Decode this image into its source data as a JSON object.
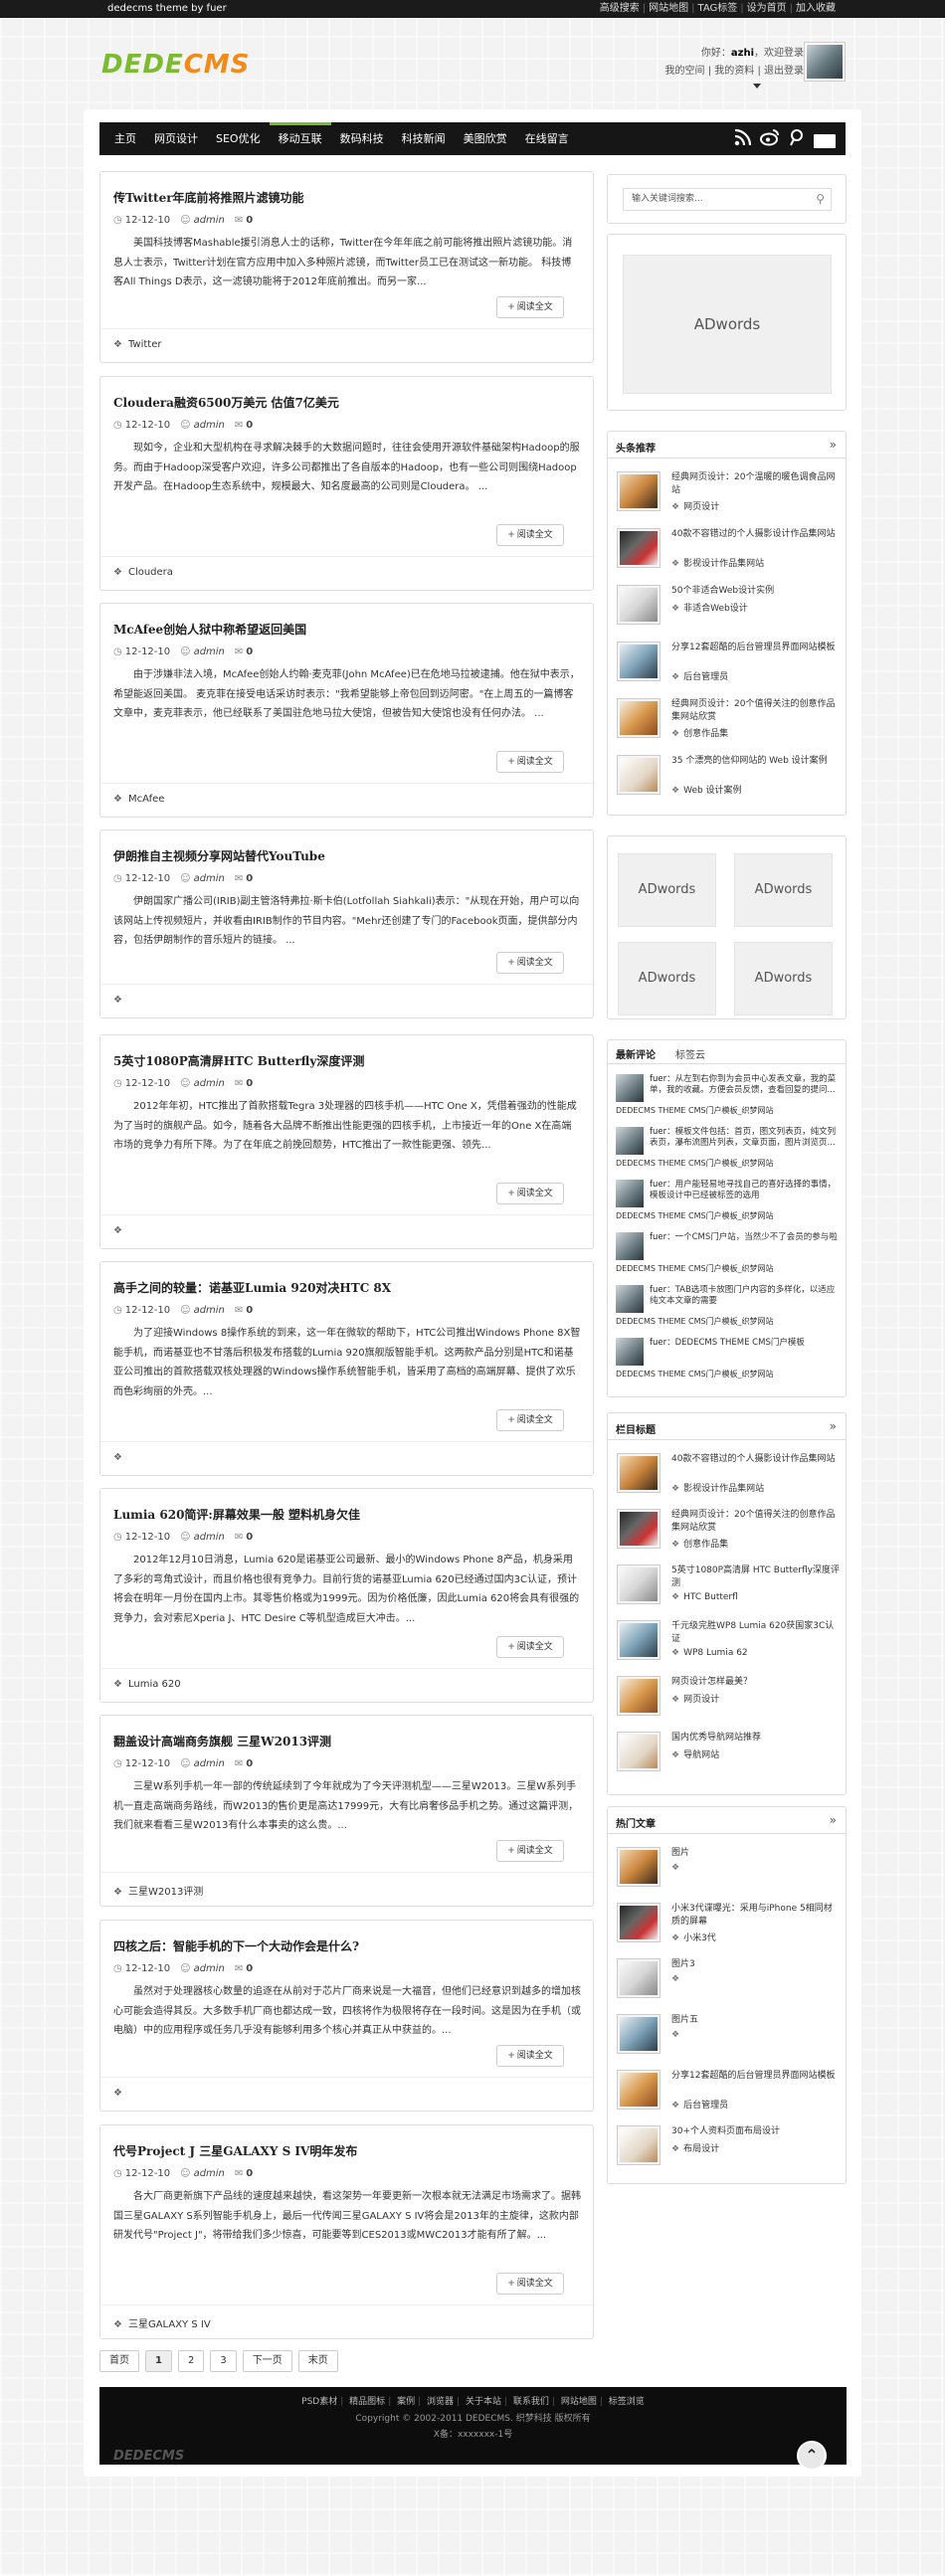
{
  "topbar": {
    "tagline": "dedecms theme by fuer",
    "links": [
      "高级搜索",
      "网站地图",
      "TAG标签",
      "设为首页",
      "加入收藏"
    ]
  },
  "logo": {
    "part1": "DEDE",
    "part2": "CMS"
  },
  "user": {
    "greeting_pre": "你好：",
    "name": "azhi",
    "greeting_post": "，欢迎登录",
    "links": [
      "我的空间",
      "我的资料",
      "退出登录"
    ]
  },
  "nav": {
    "items": [
      "主页",
      "网页设计",
      "SEO优化",
      "移动互联",
      "数码科技",
      "科技新闻",
      "美图欣赏",
      "在线留言"
    ],
    "active": 3
  },
  "more_label": "阅读全文",
  "posts": [
    {
      "title": "传Twitter年底前将推照片滤镜功能",
      "date": "12-12-10",
      "author": "admin",
      "comments": "0",
      "excerpt": "美国科技博客Mashable援引消息人士的话称，Twitter在今年年底之前可能将推出照片滤镜功能。消息人士表示，Twitter计划在官方应用中加入多种照片滤镜，而Twitter员工已在测试这一新功能。      科技博客All Things D表示，这一滤镜功能将于2012年底前推出。而另一家...",
      "tag": "Twitter"
    },
    {
      "title": "Cloudera融资6500万美元 估值7亿美元",
      "date": "12-12-10",
      "author": "admin",
      "comments": "0",
      "excerpt": "现如今，企业和大型机构在寻求解决棘手的大数据问题时，往往会使用开源软件基础架构Hadoop的服务。而由于Hadoop深受客户欢迎，许多公司都推出了各自版本的Hadoop，也有一些公司则围绕Hadoop开发产品。在Hadoop生态系统中，规模最大、知名度最高的公司则是Cloudera。 ...",
      "tag": "Cloudera"
    },
    {
      "title": "McAfee创始人狱中称希望返回美国",
      "date": "12-12-10",
      "author": "admin",
      "comments": "0",
      "excerpt": "由于涉嫌非法入境，McAfee创始人约翰·麦克菲(John McAfee)已在危地马拉被逮捕。他在狱中表示，希望能返回美国。        麦克菲在接受电话采访时表示：\"我希望能够上帝包回到迈阿密。\"在上周五的一篇博客文章中，麦克菲表示，他已经联系了美国驻危地马拉大使馆，但被告知大使馆也没有任何办法。 ...",
      "tag": "McAfee"
    },
    {
      "title": "伊朗推自主视频分享网站替代YouTube",
      "date": "12-12-10",
      "author": "admin",
      "comments": "0",
      "excerpt": "伊朗国家广播公司(IRIB)副主管洛特弗拉·斯卡伯(Lotfollah Siahkali)表示：\"从现在开始，用户可以向该网站上传视频短片，并收看由IRIB制作的节目内容。\"Mehr还创建了专门的Facebook页面，提供部分内容，包括伊朗制作的音乐短片的链接。 ...",
      "tag": ""
    },
    {
      "title": "5英寸1080P高清屏HTC Butterfly深度评测",
      "date": "12-12-10",
      "author": "admin",
      "comments": "0",
      "excerpt": "2012年年初，HTC推出了首款搭载Tegra 3处理器的四核手机——HTC One X，凭借着强劲的性能成为了当时的旗舰产品。如今，随着各大品牌不断推出性能更强的四核手机，上市接近一年的One X在高端市场的竞争力有所下降。为了在年底之前挽回颓势，HTC推出了一款性能更强、领先...",
      "tag": ""
    },
    {
      "title": "高手之间的较量：诺基亚Lumia 920对决HTC 8X",
      "date": "12-12-10",
      "author": "admin",
      "comments": "0",
      "excerpt": "为了迎接Windows 8操作系统的到来，这一年在微软的帮助下，HTC公司推出Windows Phone 8X智能手机，而诺基亚也不甘落后积极发布搭载的Lumia 920旗舰版智能手机。这两款产品分别是HTC和诺基亚公司推出的首款搭载双核处理器的Windows操作系统智能手机，皆采用了高档的高端屏幕、提供了欢乐而色彩绚丽的外壳。...",
      "tag": ""
    },
    {
      "title": "Lumia 620简评:屏幕效果一般 塑料机身欠佳",
      "date": "12-12-10",
      "author": "admin",
      "comments": "0",
      "excerpt": "2012年12月10日消息，Lumia 620是诺基亚公司最新、最小的Windows Phone 8产品，机身采用了多彩的弯角式设计，而且价格也很有竞争力。目前行货的诺基亚Lumia 620已经通过国内3C认证，预计将会在明年一月份在国内上市。其零售价格或为1999元。因为价格低廉，因此Lumia 620将会具有很强的竞争力，会对索尼Xperia J、HTC Desire C等机型造成巨大冲击。...",
      "tag": "Lumia 620"
    },
    {
      "title": "翻盖设计高端商务旗舰 三星W2013评测",
      "date": "12-12-10",
      "author": "admin",
      "comments": "0",
      "excerpt": "三星W系列手机一年一部的传统延续到了今年就成为了今天评测机型——三星W2013。三星W系列手机一直走高端商务路线，而W2013的售价更是高达17999元，大有比肩奢侈品手机之势。通过这篇评测，我们就来看看三星W2013有什么本事卖的这么贵。...",
      "tag": "三星W2013评测"
    },
    {
      "title": "四核之后：智能手机的下一个大动作会是什么?",
      "date": "12-12-10",
      "author": "admin",
      "comments": "0",
      "excerpt": "虽然对于处理器核心数量的追逐在从前对于芯片厂商来说是一大福音，但他们已经意识到越多的增加核心可能会造得其反。大多数手机厂商也都达成一致，四核将作为极限将存在一段时间。这是因为在手机（或电脑）中的应用程序或任务几乎没有能够利用多个核心并真正从中获益的。...",
      "tag": ""
    },
    {
      "title": "代号Project J 三星GALAXY S IV明年发布",
      "date": "12-12-10",
      "author": "admin",
      "comments": "0",
      "excerpt": "各大厂商更新旗下产品线的速度越来越快，看这架势一年要更新一次根本就无法满足市场需求了。据韩国三星GALAXY S系列智能手机身上，最后一代传闻三星GALAXY S IV将会是2013年的主旋律，这款内部研发代号\"Project J\"，将带给我们多少惊喜，可能要等到CES2013或MWC2013才能有所了解。...",
      "tag": "三星GALAXY S IV"
    }
  ],
  "pager": [
    "首页",
    "1",
    "2",
    "3",
    "下一页",
    "末页"
  ],
  "footer": {
    "links": [
      "PSD素材",
      "精品图标",
      "案例",
      "浏览器",
      "关于本站",
      "联系我们",
      "网站地图",
      "标签浏览"
    ],
    "copyright": "Copyright © 2002-2011 DEDECMS. 织梦科技 版权所有",
    "icp": "X备：xxxxxxx-1号",
    "logo": "DEDECMS",
    "top_icon": "⌃"
  },
  "sidebar": {
    "search_placeholder": "输入关键词搜索...",
    "ad_label": "ADwords",
    "recommend": {
      "title": "头条推荐",
      "items": [
        {
          "title": "经典网页设计：20个温暖的暖色调食品网站",
          "cat": "网页设计"
        },
        {
          "title": "40款不容错过的个人摄影设计作品集网站",
          "cat": "影视设计作品集网站"
        },
        {
          "title": "50个非适合Web设计实例",
          "cat": "非适合Web设计"
        },
        {
          "title": "分享12套超酷的后台管理员界面网站模板",
          "cat": "后台管理员"
        },
        {
          "title": "经典网页设计：20个值得关注的创意作品集网站欣赏",
          "cat": "创意作品集"
        },
        {
          "title": "35 个漂亮的信仰网站的 Web 设计案例",
          "cat": "Web 设计案例"
        }
      ]
    },
    "comments": {
      "tab1": "最新评论",
      "tab2": "标签云",
      "items": [
        {
          "user": "fuer",
          "text": "从左到右你到为会员中心发表文章，我的菜单，我的收藏。方便会员反馈，查看回复的提问..."
        },
        {
          "user": "fuer",
          "text": "模板文件包括：首页，图文列表页，纯文列表页，瀑布流图片列表，文章页面，图片浏览页..."
        },
        {
          "user": "fuer",
          "text": "用户能轻易地寻找自己的喜好选择的事情，模板设计中已经被标签的选用"
        },
        {
          "user": "fuer",
          "text": "一个CMS门户站，当然少不了会员的参与啦"
        },
        {
          "user": "fuer",
          "text": "TAB选项卡放图门户内容的多样化，以适应纯文本文章的需要"
        },
        {
          "user": "fuer",
          "text": "DEDECMS THEME CMS门户模板"
        }
      ],
      "source": "DEDECMS THEME CMS门户模板_织梦网站"
    },
    "columns": {
      "title": "栏目标题",
      "items": [
        {
          "title": "40款不容错过的个人摄影设计作品集网站",
          "cat": "影视设计作品集网站"
        },
        {
          "title": "经典网页设计：20个值得关注的创意作品集网站欣赏",
          "cat": "创意作品集"
        },
        {
          "title": "5英寸1080P高清屏 HTC Butterfly深度评测",
          "cat": "HTC Butterfl"
        },
        {
          "title": "千元级完胜WP8 Lumia 620获国家3C认证",
          "cat": "WP8 Lumia 62"
        },
        {
          "title": "网页设计怎样最美？",
          "cat": "网页设计"
        },
        {
          "title": "国内优秀导航网站推荐",
          "cat": "导航网站"
        }
      ]
    },
    "hot": {
      "title": "热门文章",
      "items": [
        {
          "title": "图片",
          "cat": ""
        },
        {
          "title": "小米3代谍曝光：采用与iPhone 5相同材质的屏幕",
          "cat": "小米3代"
        },
        {
          "title": "图片3",
          "cat": ""
        },
        {
          "title": "图片五",
          "cat": ""
        },
        {
          "title": "分享12套超酷的后台管理员界面网站模板",
          "cat": "后台管理员"
        },
        {
          "title": "30+个人资料页面布局设计",
          "cat": "布局设计"
        }
      ]
    }
  },
  "colors": {
    "nav_bg": "#161616",
    "accent": "#7bbb2e",
    "logo_orange": "#f28a1a",
    "footer_bg": "#0d0d0d"
  }
}
